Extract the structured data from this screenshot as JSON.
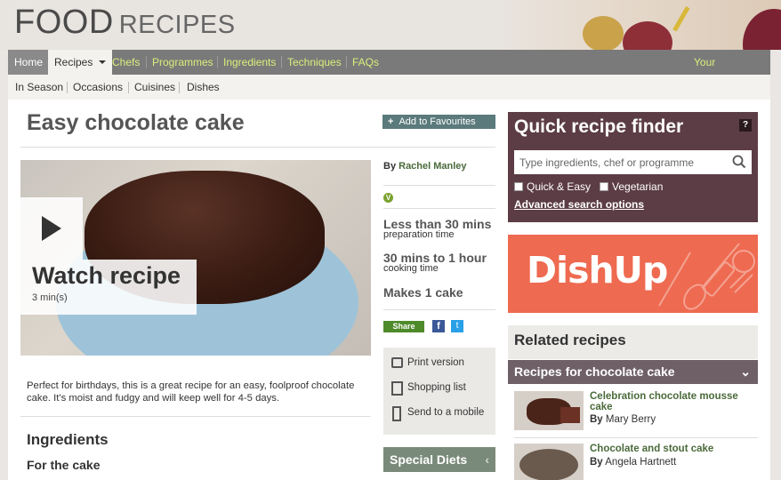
{
  "site": {
    "logo_main": "FOOD",
    "logo_sub": "RECIPES"
  },
  "nav": {
    "items": [
      "Home",
      "Recipes",
      "Chefs",
      "Programmes",
      "Ingredients",
      "Techniques",
      "FAQs"
    ],
    "favourites": "Your Favourites",
    "sub_items": [
      "In Season",
      "Occasions",
      "Cuisines",
      "Dishes"
    ]
  },
  "recipe": {
    "title": "Easy chocolate cake",
    "add_favourites": "Add to Favourites",
    "watch_title": "Watch recipe",
    "watch_duration": "3 min(s)",
    "by_prefix": "By",
    "author": "Rachel Manley",
    "veg_badge": "V",
    "prep_big": "Less than 30 mins",
    "prep_small": "preparation time",
    "cook_big": "30 mins to 1 hour",
    "cook_small": "cooking time",
    "makes": "Makes 1 cake",
    "share": "Share",
    "intro": "Perfect for birthdays, this is a great recipe for an easy, foolproof chocolate cake. It's moist and fudgy and will keep well for 4-5 days.",
    "ingredients_heading": "Ingredients",
    "for_the_cake": "For the cake"
  },
  "tools": {
    "print": "Print version",
    "shopping": "Shopping list",
    "mobile": "Send to a mobile"
  },
  "special_diets": "Special Diets",
  "finder": {
    "title": "Quick recipe finder",
    "help": "?",
    "placeholder": "Type ingredients, chef or programme",
    "quick_easy": "Quick & Easy",
    "vegetarian": "Vegetarian",
    "advanced": "Advanced search options"
  },
  "promo": {
    "label": "DishUp"
  },
  "related": {
    "heading": "Related recipes",
    "subheading": "Recipes for chocolate cake",
    "items": [
      {
        "title": "Celebration chocolate mousse cake",
        "by": "By",
        "author": "Mary Berry"
      },
      {
        "title": "Chocolate and stout cake",
        "by": "By",
        "author": "Angela Hartnett"
      }
    ]
  },
  "colors": {
    "nav_link": "#d8ef7a",
    "accent_green": "#4a6a3a",
    "finder_bg": "#5c3d45",
    "promo_bg": "#ee6a50"
  }
}
